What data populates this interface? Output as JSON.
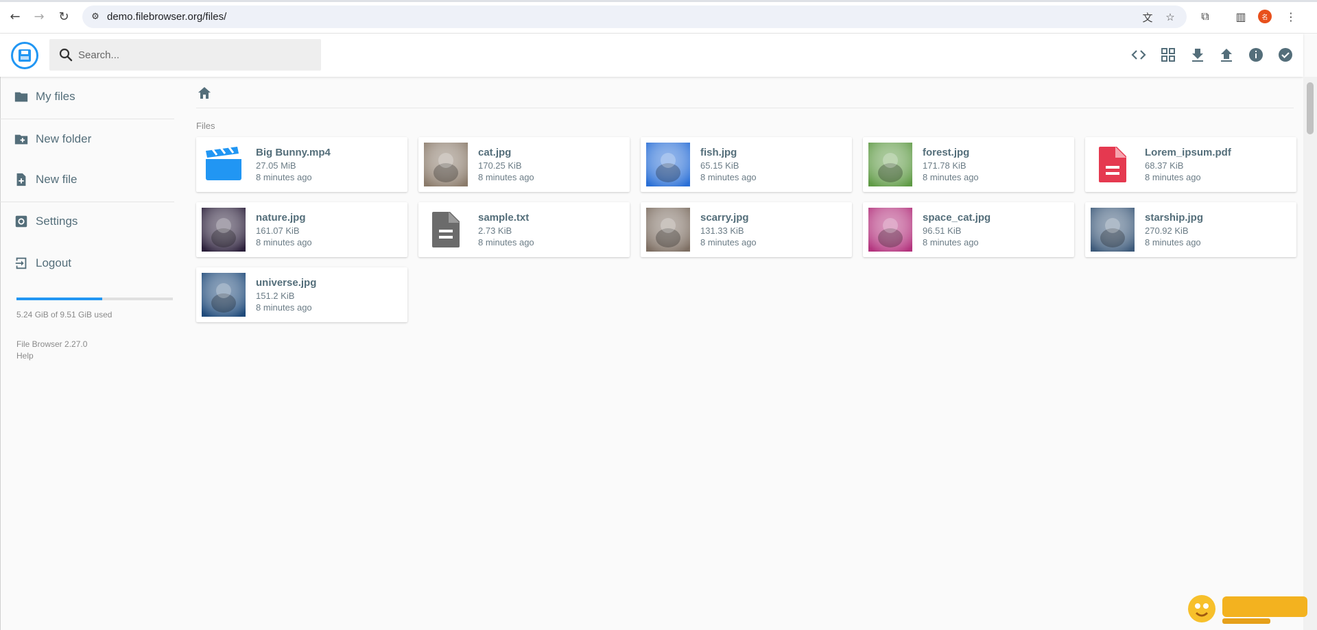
{
  "browser": {
    "url": "demo.filebrowser.org/files/",
    "back_icon": "arrow-left-icon",
    "forward_icon": "arrow-right-icon",
    "reload_icon": "reload-icon",
    "profile_initial": "名"
  },
  "header": {
    "search_placeholder": "Search...",
    "actions": [
      "code-icon",
      "grid-view-icon",
      "download-icon",
      "upload-icon",
      "info-icon",
      "check-circle-icon"
    ]
  },
  "sidebar": {
    "items": [
      {
        "label": "My files",
        "icon": "folder-icon"
      },
      {
        "label": "New folder",
        "icon": "create-new-folder-icon"
      },
      {
        "label": "New file",
        "icon": "note-add-icon"
      },
      {
        "label": "Settings",
        "icon": "settings-icon"
      },
      {
        "label": "Logout",
        "icon": "exit-icon"
      }
    ],
    "usage_text": "5.24 GiB of 9.51 GiB used",
    "usage_fraction": 0.55,
    "version": "File Browser 2.27.0",
    "help": "Help"
  },
  "main": {
    "section_title": "Files",
    "files": [
      {
        "name": "Big Bunny.mp4",
        "size": "27.05 MiB",
        "modified": "8 minutes ago",
        "kind": "video-icon"
      },
      {
        "name": "cat.jpg",
        "size": "170.25 KiB",
        "modified": "8 minutes ago",
        "kind": "image-thumbnail",
        "color": "#8a7a6a"
      },
      {
        "name": "fish.jpg",
        "size": "65.15 KiB",
        "modified": "8 minutes ago",
        "kind": "image-thumbnail",
        "color": "#2a6fd6"
      },
      {
        "name": "forest.jpg",
        "size": "171.78 KiB",
        "modified": "8 minutes ago",
        "kind": "image-thumbnail",
        "color": "#5f9a45"
      },
      {
        "name": "Lorem_ipsum.pdf",
        "size": "68.37 KiB",
        "modified": "8 minutes ago",
        "kind": "pdf-icon"
      },
      {
        "name": "nature.jpg",
        "size": "161.07 KiB",
        "modified": "8 minutes ago",
        "kind": "image-thumbnail",
        "color": "#2b1f3a"
      },
      {
        "name": "sample.txt",
        "size": "2.73 KiB",
        "modified": "8 minutes ago",
        "kind": "text-file-icon"
      },
      {
        "name": "scarry.jpg",
        "size": "131.33 KiB",
        "modified": "8 minutes ago",
        "kind": "image-thumbnail",
        "color": "#7d6e62"
      },
      {
        "name": "space_cat.jpg",
        "size": "96.51 KiB",
        "modified": "8 minutes ago",
        "kind": "image-thumbnail",
        "color": "#b3337d"
      },
      {
        "name": "starship.jpg",
        "size": "270.92 KiB",
        "modified": "8 minutes ago",
        "kind": "image-thumbnail",
        "color": "#3d5a7a"
      },
      {
        "name": "universe.jpg",
        "size": "151.2 KiB",
        "modified": "8 minutes ago",
        "kind": "image-thumbnail",
        "color": "#1f4a7a"
      }
    ]
  },
  "colors": {
    "accent": "#2196f3",
    "pdf": "#e53950",
    "text": "#546e7a",
    "txt_icon": "#6b6b6b"
  }
}
